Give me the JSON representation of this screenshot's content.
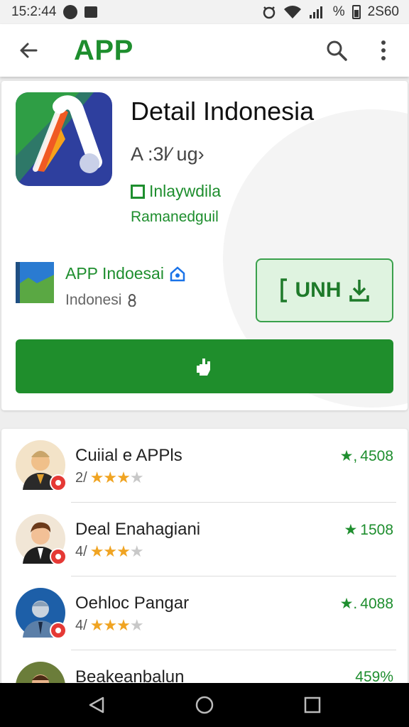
{
  "status_bar": {
    "time": "15:2:44",
    "right_text": "%",
    "right_extra": "2S60"
  },
  "app_bar": {
    "title": "APP"
  },
  "detail": {
    "title": "Detail Indonesia",
    "subtitle": "A :3l⁄ ug›",
    "tag": "Inlaywdila",
    "meta": "Ramanedguil",
    "developer_name": "APP Indoesai",
    "developer_sub": "Indonesi",
    "secondary_button_label": "UNH",
    "colors": {
      "accent": "#1e8e2e",
      "button": "#1f8e2c",
      "button_light": "#dff3e0"
    }
  },
  "list": {
    "items": [
      {
        "name": "Cuiial e APPls",
        "rating_prefix": "2/",
        "stars": 3,
        "value": "4508"
      },
      {
        "name": "Deal Enahagiani",
        "rating_prefix": "4/",
        "stars": 3,
        "value": "1508"
      },
      {
        "name": "Oehloc Pangar",
        "rating_prefix": "4/",
        "stars": 3,
        "value": "4088"
      },
      {
        "name": "Beakeanbalun",
        "rating_prefix": "",
        "stars": 0,
        "value": "459%"
      }
    ],
    "value_prefixes": [
      "★,",
      "★ ",
      "★.",
      ""
    ]
  },
  "icons": [
    "back-arrow-icon",
    "search-icon",
    "more-vert-icon",
    "nav-back-icon",
    "nav-home-icon",
    "nav-recents-icon"
  ]
}
